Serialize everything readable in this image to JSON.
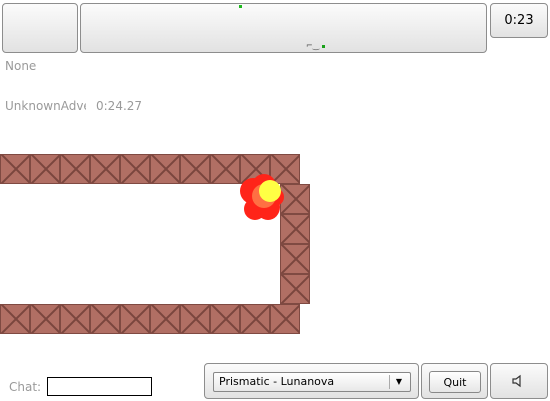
{
  "header": {
    "timer": "0:23"
  },
  "status": {
    "player": "None",
    "score_name": "UnknownAdventurer",
    "score_time": "0:24.27"
  },
  "chat": {
    "label": "Chat:",
    "value": ""
  },
  "controls": {
    "track_selected": "Prismatic - Lunanova",
    "quit_label": "Quit",
    "sound_icon": "speaker-icon"
  },
  "colors": {
    "crate": "#b16f64",
    "ball_core": "#ffff44",
    "ball_glow": "#ff2a1a",
    "minimap_dot": "#1eb91e"
  }
}
